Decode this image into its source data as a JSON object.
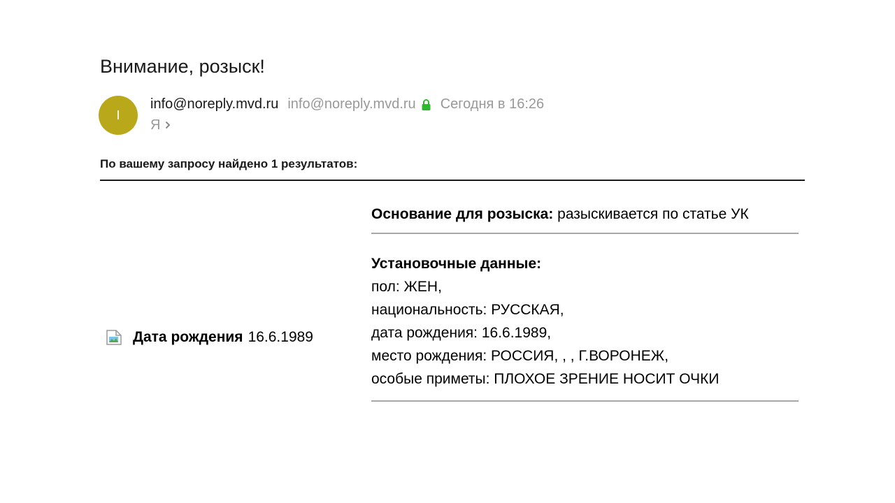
{
  "email": {
    "subject": "Внимание, розыск!",
    "avatar_letter": "I",
    "sender_name": "info@noreply.mvd.ru",
    "sender_email": "info@noreply.mvd.ru",
    "date": "Сегодня в 16:26",
    "recipient": "Я",
    "icons": {
      "verified": "lock-icon",
      "expand": "chevron-right-icon"
    },
    "colors": {
      "avatar": "#b9a81a",
      "verified": "#2eb82e"
    }
  },
  "body": {
    "results_title": "По вашему запросу найдено 1 результатов:",
    "left": {
      "label": "Дата рождения",
      "value": "16.6.1989"
    },
    "basis": {
      "label": "Основание для розыска:",
      "value": "разыскивается по статье УК"
    },
    "details": {
      "title": "Установочные данные:",
      "lines": [
        "пол: ЖЕН,",
        "национальность: РУССКАЯ,",
        "дата рождения: 16.6.1989,",
        "место рождения: РОССИЯ, , , Г.ВОРОНЕЖ,",
        "особые приметы: ПЛОХОЕ ЗРЕНИЕ НОСИТ ОЧКИ"
      ]
    }
  }
}
